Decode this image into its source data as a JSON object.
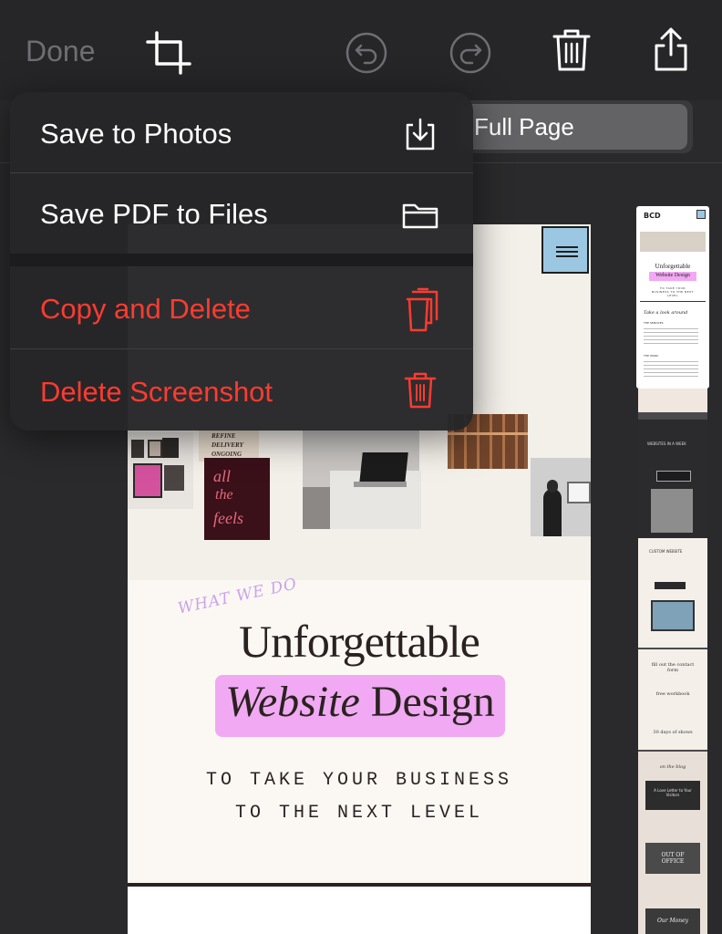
{
  "toolbar": {
    "done_label": "Done",
    "icons": [
      "crop-icon",
      "undo-icon",
      "redo-icon",
      "trash-icon",
      "share-icon"
    ]
  },
  "segmented": {
    "active_label": "Full Page"
  },
  "menu": {
    "items": [
      {
        "label": "Save to Photos",
        "icon": "save-to-photos-icon",
        "color": "#ffffff"
      },
      {
        "label": "Save PDF to Files",
        "icon": "folder-icon",
        "color": "#ffffff"
      },
      {
        "label": "Copy and Delete",
        "icon": "copy-delete-icon",
        "color": "#ff3b30"
      },
      {
        "label": "Delete Screenshot",
        "icon": "trash-icon",
        "color": "#ff3b30"
      }
    ]
  },
  "preview": {
    "photo_caption_lines": [
      "REFINE",
      "DELIVERY",
      "ONGOING"
    ],
    "neon_text": [
      "all",
      "the",
      "feels"
    ],
    "kicker": "WHAT WE DO",
    "headline_1": "Unforgettable",
    "headline_2_italic": "Website",
    "headline_2_rest": "Design",
    "tagline_1": "TO TAKE YOUR BUSINESS",
    "tagline_2": "TO THE NEXT LEVEL",
    "highlight_color": "#f1a9f3",
    "menu_box_color": "#9cc7e2"
  },
  "thumbnail": {
    "logo": "BCD",
    "headline": "Unforgettable",
    "headline_2": "Website Design",
    "tagline": "TO TAKE YOUR BUSINESS TO THE NEXT LEVEL",
    "section": "Take a look around",
    "services": "THE SERVICES",
    "work": "THE WORK",
    "websites": "WEBSITES IN A WEEK",
    "custom": "CUSTOM WEBSITE",
    "fill_out": "fill out the contact form",
    "free": "free workbook",
    "days": "30 days of shows",
    "blog": "on the blog",
    "post1": "A Love Letter to Your Visitors",
    "post2": "OUT OF OFFICE",
    "post3": "Our Money"
  }
}
